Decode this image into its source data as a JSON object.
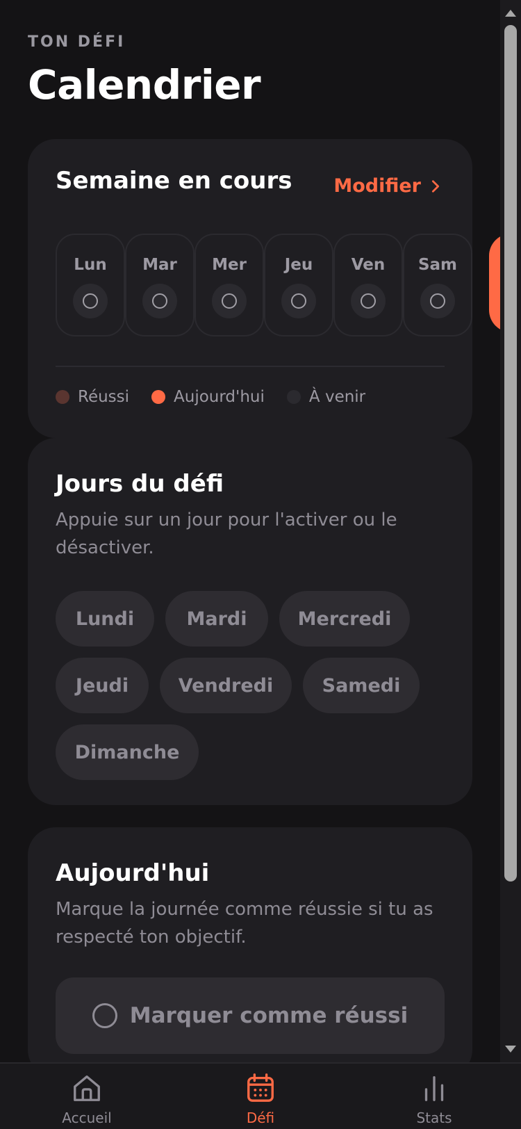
{
  "header": {
    "eyebrow": "TON DÉFI",
    "title": "Calendrier"
  },
  "week_card": {
    "title": "Semaine en cours",
    "edit_label": "Modifier",
    "days": [
      {
        "abbr": "Lun"
      },
      {
        "abbr": "Mar"
      },
      {
        "abbr": "Mer"
      },
      {
        "abbr": "Jeu"
      },
      {
        "abbr": "Ven"
      },
      {
        "abbr": "Sam"
      }
    ],
    "legend": [
      {
        "label": "Réussi",
        "color": "#5a3530"
      },
      {
        "label": "Aujourd'hui",
        "color": "#ff6a45"
      },
      {
        "label": "À venir",
        "color": "#2b2a2f"
      }
    ]
  },
  "days_card": {
    "title": "Jours du défi",
    "subtitle": "Appuie sur un jour pour l'activer ou le désactiver.",
    "chips": [
      "Lundi",
      "Mardi",
      "Mercredi",
      "Jeudi",
      "Vendredi",
      "Samedi",
      "Dimanche"
    ]
  },
  "today_card": {
    "title": "Aujourd'hui",
    "subtitle": "Marque la journée comme réussie si tu as respecté ton objectif.",
    "button_label": "Marquer comme réussi"
  },
  "tabbar": {
    "tabs": [
      {
        "label": "Accueil",
        "icon": "home-icon",
        "active": false
      },
      {
        "label": "Défi",
        "icon": "calendar-icon",
        "active": true
      },
      {
        "label": "Stats",
        "icon": "bar-chart-icon",
        "active": false
      }
    ]
  },
  "colors": {
    "accent": "#ff6a45",
    "background": "#141315",
    "card": "#1f1e22"
  }
}
